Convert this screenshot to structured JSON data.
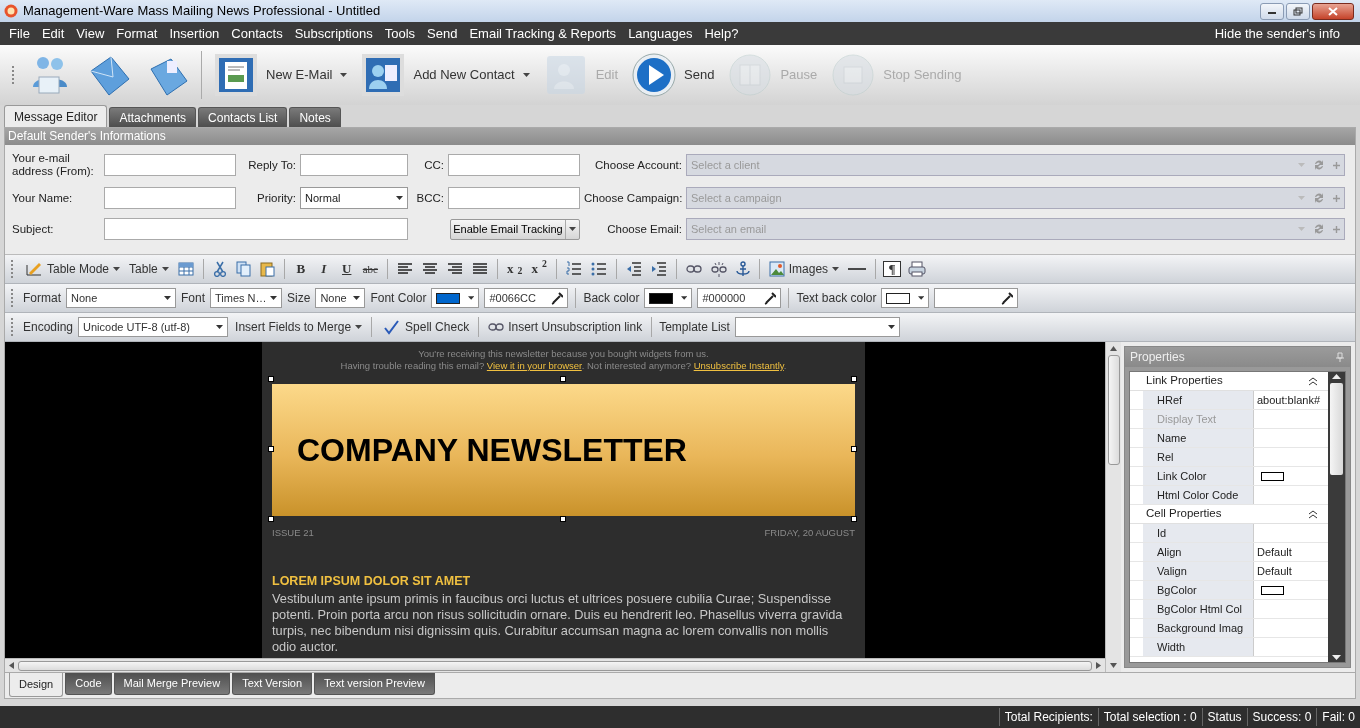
{
  "window": {
    "title": "Management-Ware Mass Mailing News Professional - Untitled"
  },
  "menu": {
    "items": [
      "File",
      "Edit",
      "View",
      "Format",
      "Insertion",
      "Contacts",
      "Subscriptions",
      "Tools",
      "Send",
      "Email Tracking & Reports",
      "Languages",
      "Help?"
    ],
    "right": "Hide the sender's info"
  },
  "toolbar": [
    {
      "kind": "icon",
      "disabled": false
    },
    {
      "kind": "icon",
      "disabled": false
    },
    {
      "kind": "icon",
      "disabled": false
    },
    {
      "kind": "separator"
    },
    {
      "kind": "labeled",
      "label": "New E-Mail",
      "dropdown": true,
      "disabled": false
    },
    {
      "kind": "labeled",
      "label": "Add New Contact",
      "dropdown": true,
      "disabled": false
    },
    {
      "kind": "labeled",
      "label": "Edit",
      "dropdown": false,
      "disabled": true
    },
    {
      "kind": "labeled",
      "label": "Send",
      "dropdown": false,
      "disabled": false
    },
    {
      "kind": "labeled",
      "label": "Pause",
      "dropdown": false,
      "disabled": true
    },
    {
      "kind": "labeled",
      "label": "Stop Sending",
      "dropdown": false,
      "disabled": true
    }
  ],
  "tabs": [
    {
      "label": "Message Editor",
      "selected": true
    },
    {
      "label": "Attachments",
      "selected": false
    },
    {
      "label": "Contacts List",
      "selected": false
    },
    {
      "label": "Notes",
      "selected": false
    }
  ],
  "sender": {
    "title": "Default Sender's Informations",
    "fields": [
      {
        "kind": "field",
        "label": "Your e-mail address (From):"
      },
      {
        "kind": "field",
        "label": "Reply To:"
      },
      {
        "kind": "field",
        "label": "CC:"
      },
      {
        "kind": "combo",
        "label": "Choose Account:",
        "placeholder": "Select a client",
        "disabled": true
      },
      {
        "kind": "field",
        "label": "Your Name:"
      },
      {
        "kind": "select",
        "label": "Priority:",
        "value": "Normal"
      },
      {
        "kind": "field",
        "label": "BCC:"
      },
      {
        "kind": "combo",
        "label": "Choose Campaign:",
        "placeholder": "Select a campaign",
        "disabled": true
      },
      {
        "kind": "wide-field",
        "label": "Subject:"
      },
      {
        "kind": "split-button",
        "text": "Enable Email Tracking"
      },
      {
        "kind": "combo",
        "label": "Choose Email:",
        "placeholder": "Select an email",
        "disabled": true
      }
    ]
  },
  "format_bars": [
    [
      {
        "kind": "icon-dropdown",
        "label": "Table Mode"
      },
      {
        "kind": "dropdown",
        "label": "Table"
      },
      {
        "kind": "icon"
      },
      {
        "kind": "separator"
      },
      {
        "kind": "icon"
      },
      {
        "kind": "icon"
      },
      {
        "kind": "icon"
      },
      {
        "kind": "separator"
      },
      {
        "kind": "bold",
        "text": "B"
      },
      {
        "kind": "italic",
        "text": "I"
      },
      {
        "kind": "underline",
        "text": "U"
      },
      {
        "kind": "strike",
        "text": "abc"
      },
      {
        "kind": "separator"
      },
      {
        "kind": "icon"
      },
      {
        "kind": "icon"
      },
      {
        "kind": "icon"
      },
      {
        "kind": "icon"
      },
      {
        "kind": "separator"
      },
      {
        "kind": "bold",
        "text": "x$_{2}$"
      },
      {
        "kind": "bold",
        "text": "x$^{2}$"
      },
      {
        "kind": "separator"
      },
      {
        "kind": "icon"
      },
      {
        "kind": "icon"
      },
      {
        "kind": "separator"
      },
      {
        "kind": "icon"
      },
      {
        "kind": "icon"
      },
      {
        "kind": "separator"
      },
      {
        "kind": "icon"
      },
      {
        "kind": "icon"
      },
      {
        "kind": "icon"
      },
      {
        "kind": "separator"
      },
      {
        "kind": "icon-dropdown",
        "label": "Images"
      },
      {
        "kind": "icon"
      },
      {
        "kind": "separator"
      },
      {
        "kind": "boxed",
        "text": "¶"
      },
      {
        "kind": "icon"
      }
    ],
    [
      {
        "kind": "label",
        "text": "Format"
      },
      {
        "kind": "select",
        "value": "None"
      },
      {
        "kind": "label",
        "text": "Font"
      },
      {
        "kind": "select",
        "value": "Times N…"
      },
      {
        "kind": "label",
        "text": "Size"
      },
      {
        "kind": "select",
        "value": "None"
      },
      {
        "kind": "label",
        "text": "Font Color"
      },
      {
        "kind": "color-select",
        "color": "#0066cc"
      },
      {
        "kind": "color-text",
        "value": "#0066CC"
      },
      {
        "kind": "separator"
      },
      {
        "kind": "label",
        "text": "Back color"
      },
      {
        "kind": "color-select",
        "color": "#000000"
      },
      {
        "kind": "color-text",
        "value": "#000000"
      },
      {
        "kind": "separator"
      },
      {
        "kind": "label",
        "text": "Text back color"
      },
      {
        "kind": "color-select",
        "color": "#ffffff"
      },
      {
        "kind": "color-text"
      }
    ],
    [
      {
        "kind": "label",
        "text": "Encoding"
      },
      {
        "kind": "select",
        "value": "Unicode UTF-8 (utf-8)"
      },
      {
        "kind": "dropdown",
        "label": "Insert Fields to Merge"
      },
      {
        "kind": "separator"
      },
      {
        "kind": "icon-button",
        "label": "Spell Check"
      },
      {
        "kind": "separator"
      },
      {
        "kind": "icon-button",
        "label": "Insert Unsubscription link"
      },
      {
        "kind": "separator"
      },
      {
        "kind": "label",
        "text": "Template List"
      },
      {
        "kind": "select"
      }
    ]
  ],
  "email": {
    "preheader": "You're receiving this newsletter because you bought widgets from us.",
    "trouble_line": [
      {
        "kind": "text",
        "text": "Having trouble reading this email?"
      },
      {
        "kind": "link",
        "text": "View it in your browser"
      },
      {
        "kind": "text",
        "text": ". Not interested anymore?"
      },
      {
        "kind": "link",
        "text": "Unsubscribe Instantly"
      },
      {
        "kind": "text",
        "text": "."
      }
    ],
    "banner_title": "COMPANY NEWSLETTER",
    "issue": "ISSUE 21",
    "date": "FRIDAY, 20 AUGUST",
    "heading": "LOREM IPSUM DOLOR SIT AMET",
    "body": "Vestibulum ante ipsum primis in faucibus orci luctus et ultrices posuere cubilia Curae; Suspendisse potenti. Proin porta arcu non risus sollicitudin ornare. Duis eu hendrerit leo. Phasellus viverra gravida turpis, nec bibendum nisi dignissim quis. Curabitur accumsan magna ac lorem convallis non mollis odio auctor."
  },
  "properties": {
    "title": "Properties",
    "groups": [
      {
        "title": "Link Properties",
        "expanded": true,
        "rows": [
          {
            "name": "HRef",
            "kind": "text",
            "value": "about:blank#",
            "disabled": false
          },
          {
            "name": "Display Text",
            "kind": "text",
            "disabled": true
          },
          {
            "name": "Name",
            "kind": "text",
            "disabled": false
          },
          {
            "name": "Rel",
            "kind": "text",
            "disabled": false
          },
          {
            "name": "Link Color",
            "kind": "color",
            "disabled": false
          },
          {
            "name": "Html Color Code",
            "kind": "text",
            "disabled": false
          }
        ]
      },
      {
        "title": "Cell Properties",
        "expanded": true,
        "rows": [
          {
            "name": "Id",
            "kind": "text",
            "disabled": false
          },
          {
            "name": "Align",
            "kind": "text",
            "value": "Default",
            "disabled": false
          },
          {
            "name": "Valign",
            "kind": "text",
            "value": "Default",
            "disabled": false
          },
          {
            "name": "BgColor",
            "kind": "color",
            "disabled": false
          },
          {
            "name": "BgColor Html Col",
            "kind": "text",
            "disabled": false
          },
          {
            "name": "Background Imag",
            "kind": "text",
            "disabled": false
          },
          {
            "name": "Width",
            "kind": "text",
            "disabled": false
          }
        ]
      }
    ]
  },
  "view_tabs": [
    {
      "label": "Design",
      "selected": true
    },
    {
      "label": "Code",
      "selected": false
    },
    {
      "label": "Mail Merge Preview",
      "selected": false
    },
    {
      "label": "Text Version",
      "selected": false
    },
    {
      "label": "Text version Preview",
      "selected": false
    }
  ],
  "status_bar": [
    "Total Recipients:",
    "Total selection : 0",
    "Status",
    "Success: 0",
    "Fail: 0"
  ]
}
